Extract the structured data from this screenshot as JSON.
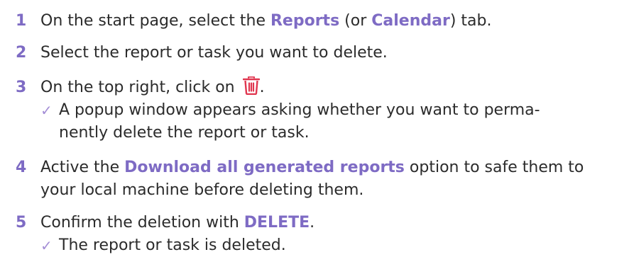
{
  "colors": {
    "accent": "#7e6bc4",
    "check": "#a48ed6",
    "trash_icon": "#e0364f",
    "text": "#2b2b2b"
  },
  "steps": [
    {
      "number": "1",
      "pre": "On the start page, select the ",
      "hl1": "Reports",
      "mid": " (or ",
      "hl2": "Calendar",
      "post": ") tab."
    },
    {
      "number": "2",
      "text": "Select the report or task you want to delete."
    },
    {
      "number": "3",
      "pre": "On the top right, click on ",
      "icon": "trash-icon",
      "post": ".",
      "result_line1": "A popup window appears asking whether you want to perma-",
      "result_line2": "nently delete the report or task."
    },
    {
      "number": "4",
      "pre": "Active the ",
      "hl": "Download all generated reports",
      "post": " option to safe them to",
      "line2": "your local machine before deleting them."
    },
    {
      "number": "5",
      "pre": "Confirm the deletion with ",
      "hl": "DELETE",
      "post": ".",
      "result": "The report or task is deleted."
    }
  ]
}
